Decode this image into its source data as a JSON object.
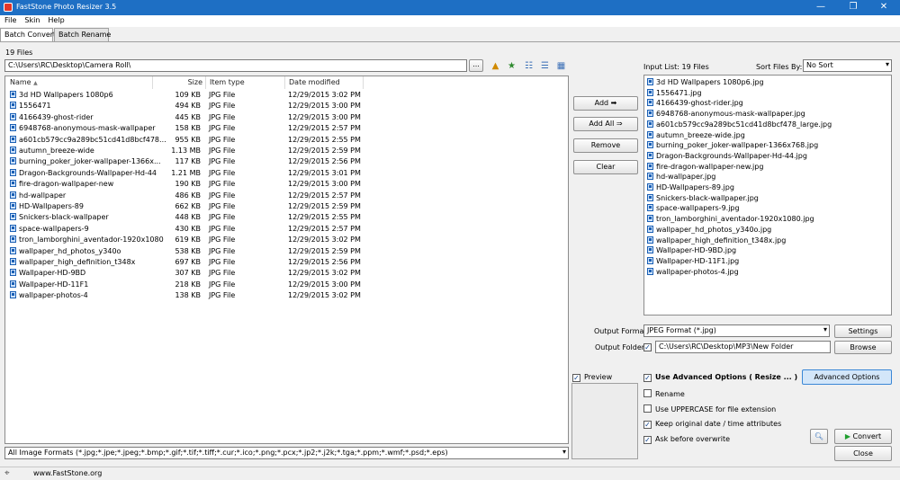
{
  "window": {
    "title": "FastStone Photo Resizer 3.5",
    "minimize": "—",
    "maximize": "❐",
    "close": "✕"
  },
  "menu": [
    "File",
    "Skin",
    "Help"
  ],
  "tabs": [
    "Batch Convert",
    "Batch Rename"
  ],
  "files_count": "19 Files",
  "path": "C:\\Users\\RC\\Desktop\\Camera Roll\\",
  "browse_label": "...",
  "columns": {
    "name": "Name",
    "size": "Size",
    "type": "Item type",
    "date": "Date modified"
  },
  "files": [
    {
      "name": "3d HD Wallpapers 1080p6",
      "size": "109 KB",
      "type": "JPG File",
      "date": "12/29/2015 3:02 PM"
    },
    {
      "name": "1556471",
      "size": "494 KB",
      "type": "JPG File",
      "date": "12/29/2015 3:00 PM"
    },
    {
      "name": "4166439-ghost-rider",
      "size": "445 KB",
      "type": "JPG File",
      "date": "12/29/2015 3:00 PM"
    },
    {
      "name": "6948768-anonymous-mask-wallpaper",
      "size": "158 KB",
      "type": "JPG File",
      "date": "12/29/2015 2:57 PM"
    },
    {
      "name": "a601cb579cc9a289bc51cd41d8bcf478...",
      "size": "955 KB",
      "type": "JPG File",
      "date": "12/29/2015 2:55 PM"
    },
    {
      "name": "autumn_breeze-wide",
      "size": "1.13 MB",
      "type": "JPG File",
      "date": "12/29/2015 2:59 PM"
    },
    {
      "name": "burning_poker_joker-wallpaper-1366x...",
      "size": "117 KB",
      "type": "JPG File",
      "date": "12/29/2015 2:56 PM"
    },
    {
      "name": "Dragon-Backgrounds-Wallpaper-Hd-44",
      "size": "1.21 MB",
      "type": "JPG File",
      "date": "12/29/2015 3:01 PM"
    },
    {
      "name": "fire-dragon-wallpaper-new",
      "size": "190 KB",
      "type": "JPG File",
      "date": "12/29/2015 3:00 PM"
    },
    {
      "name": "hd-wallpaper",
      "size": "486 KB",
      "type": "JPG File",
      "date": "12/29/2015 2:57 PM"
    },
    {
      "name": "HD-Wallpapers-89",
      "size": "662 KB",
      "type": "JPG File",
      "date": "12/29/2015 2:59 PM"
    },
    {
      "name": "Snickers-black-wallpaper",
      "size": "448 KB",
      "type": "JPG File",
      "date": "12/29/2015 2:55 PM"
    },
    {
      "name": "space-wallpapers-9",
      "size": "430 KB",
      "type": "JPG File",
      "date": "12/29/2015 2:57 PM"
    },
    {
      "name": "tron_lamborghini_aventador-1920x1080",
      "size": "619 KB",
      "type": "JPG File",
      "date": "12/29/2015 3:02 PM"
    },
    {
      "name": "wallpaper_hd_photos_y340o",
      "size": "538 KB",
      "type": "JPG File",
      "date": "12/29/2015 2:59 PM"
    },
    {
      "name": "wallpaper_high_definition_t348x",
      "size": "697 KB",
      "type": "JPG File",
      "date": "12/29/2015 2:56 PM"
    },
    {
      "name": "Wallpaper-HD-9BD",
      "size": "307 KB",
      "type": "JPG File",
      "date": "12/29/2015 3:02 PM"
    },
    {
      "name": "Wallpaper-HD-11F1",
      "size": "218 KB",
      "type": "JPG File",
      "date": "12/29/2015 3:00 PM"
    },
    {
      "name": "wallpaper-photos-4",
      "size": "138 KB",
      "type": "JPG File",
      "date": "12/29/2015 3:02 PM"
    }
  ],
  "filter": "All Image Formats (*.jpg;*.jpe;*.jpeg;*.bmp;*.gif;*.tif;*.tiff;*.cur;*.ico;*.png;*.pcx;*.jp2;*.j2k;*.tga;*.ppm;*.wmf;*.psd;*.eps)",
  "buttons": {
    "add": "Add",
    "add_all": "Add All",
    "remove": "Remove",
    "clear": "Clear"
  },
  "input_list": {
    "label": "Input List: 19 Files",
    "sort_label": "Sort Files By:",
    "sort_value": "No Sort",
    "items": [
      "3d HD Wallpapers 1080p6.jpg",
      "1556471.jpg",
      "4166439-ghost-rider.jpg",
      "6948768-anonymous-mask-wallpaper.jpg",
      "a601cb579cc9a289bc51cd41d8bcf478_large.jpg",
      "autumn_breeze-wide.jpg",
      "burning_poker_joker-wallpaper-1366x768.jpg",
      "Dragon-Backgrounds-Wallpaper-Hd-44.jpg",
      "fire-dragon-wallpaper-new.jpg",
      "hd-wallpaper.jpg",
      "HD-Wallpapers-89.jpg",
      "Snickers-black-wallpaper.jpg",
      "space-wallpapers-9.jpg",
      "tron_lamborghini_aventador-1920x1080.jpg",
      "wallpaper_hd_photos_y340o.jpg",
      "wallpaper_high_definition_t348x.jpg",
      "Wallpaper-HD-9BD.jpg",
      "Wallpaper-HD-11F1.jpg",
      "wallpaper-photos-4.jpg"
    ]
  },
  "output": {
    "format_label": "Output Format:",
    "format_value": "JPEG Format (*.jpg)",
    "settings": "Settings",
    "folder_label": "Output Folder:",
    "folder_value": "C:\\Users\\RC\\Desktop\\MP3\\New Folder",
    "browse": "Browse"
  },
  "preview_label": "Preview",
  "options": {
    "advanced": "Use Advanced Options ( Resize ... )",
    "advanced_btn": "Advanced Options",
    "rename": "Rename",
    "uppercase": "Use UPPERCASE for file extension",
    "keep_date": "Keep original date / time attributes",
    "ask_overwrite": "Ask before overwrite"
  },
  "convert": "Convert",
  "close": "Close",
  "website": "www.FastStone.org",
  "colors": {
    "titlebar": "#1e6fc4",
    "accent_blue": "#3a87d6",
    "convert_green": "#1f9e2e"
  }
}
